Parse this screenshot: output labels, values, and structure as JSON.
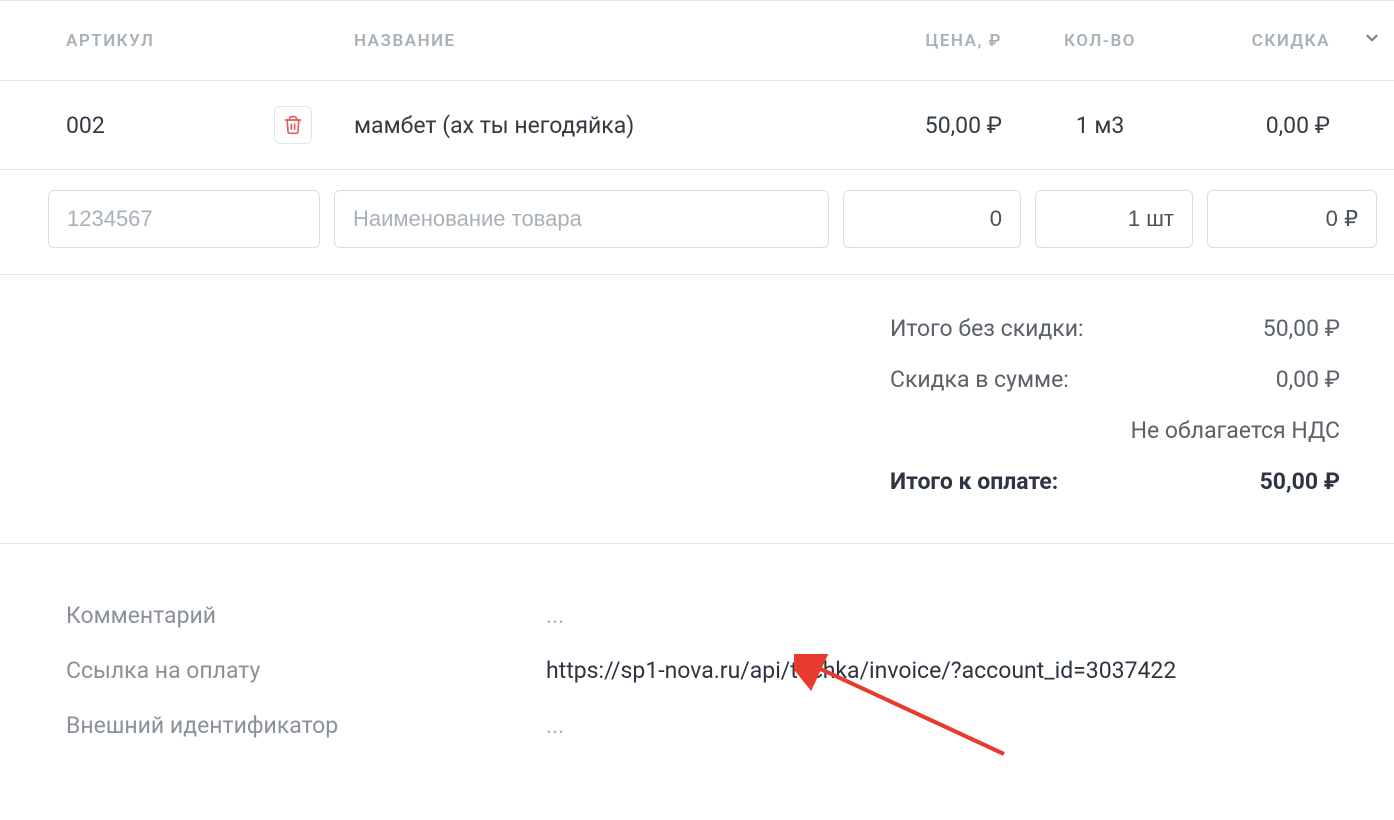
{
  "headers": {
    "article": "АРТИКУЛ",
    "name": "НАЗВАНИЕ",
    "price": "ЦЕНА, ₽",
    "qty": "КОЛ-ВО",
    "discount": "СКИДКА"
  },
  "row": {
    "article": "002",
    "name": "мамбет (ах ты негодяйка)",
    "price": "50,00 ₽",
    "qty": "1 м3",
    "discount": "0,00 ₽"
  },
  "inputs": {
    "article_placeholder": "1234567",
    "name_placeholder": "Наименование товара",
    "price_value": "0",
    "qty_value": "1 шт",
    "discount_value": "0 ₽"
  },
  "totals": {
    "subtotal_label": "Итого без скидки:",
    "subtotal_value": "50,00 ₽",
    "discount_label": "Скидка в сумме:",
    "discount_value": "0,00 ₽",
    "vat_note": "Не облагается НДС",
    "total_label": "Итого к оплате:",
    "total_value": "50,00 ₽"
  },
  "details": {
    "comment_label": "Комментарий",
    "comment_value": "...",
    "paylink_label": "Ссылка на оплату",
    "paylink_value": "https://sp1-nova.ru/api/tochka/invoice/?account_id=3037422",
    "extid_label": "Внешний идентификатор",
    "extid_value": "..."
  }
}
